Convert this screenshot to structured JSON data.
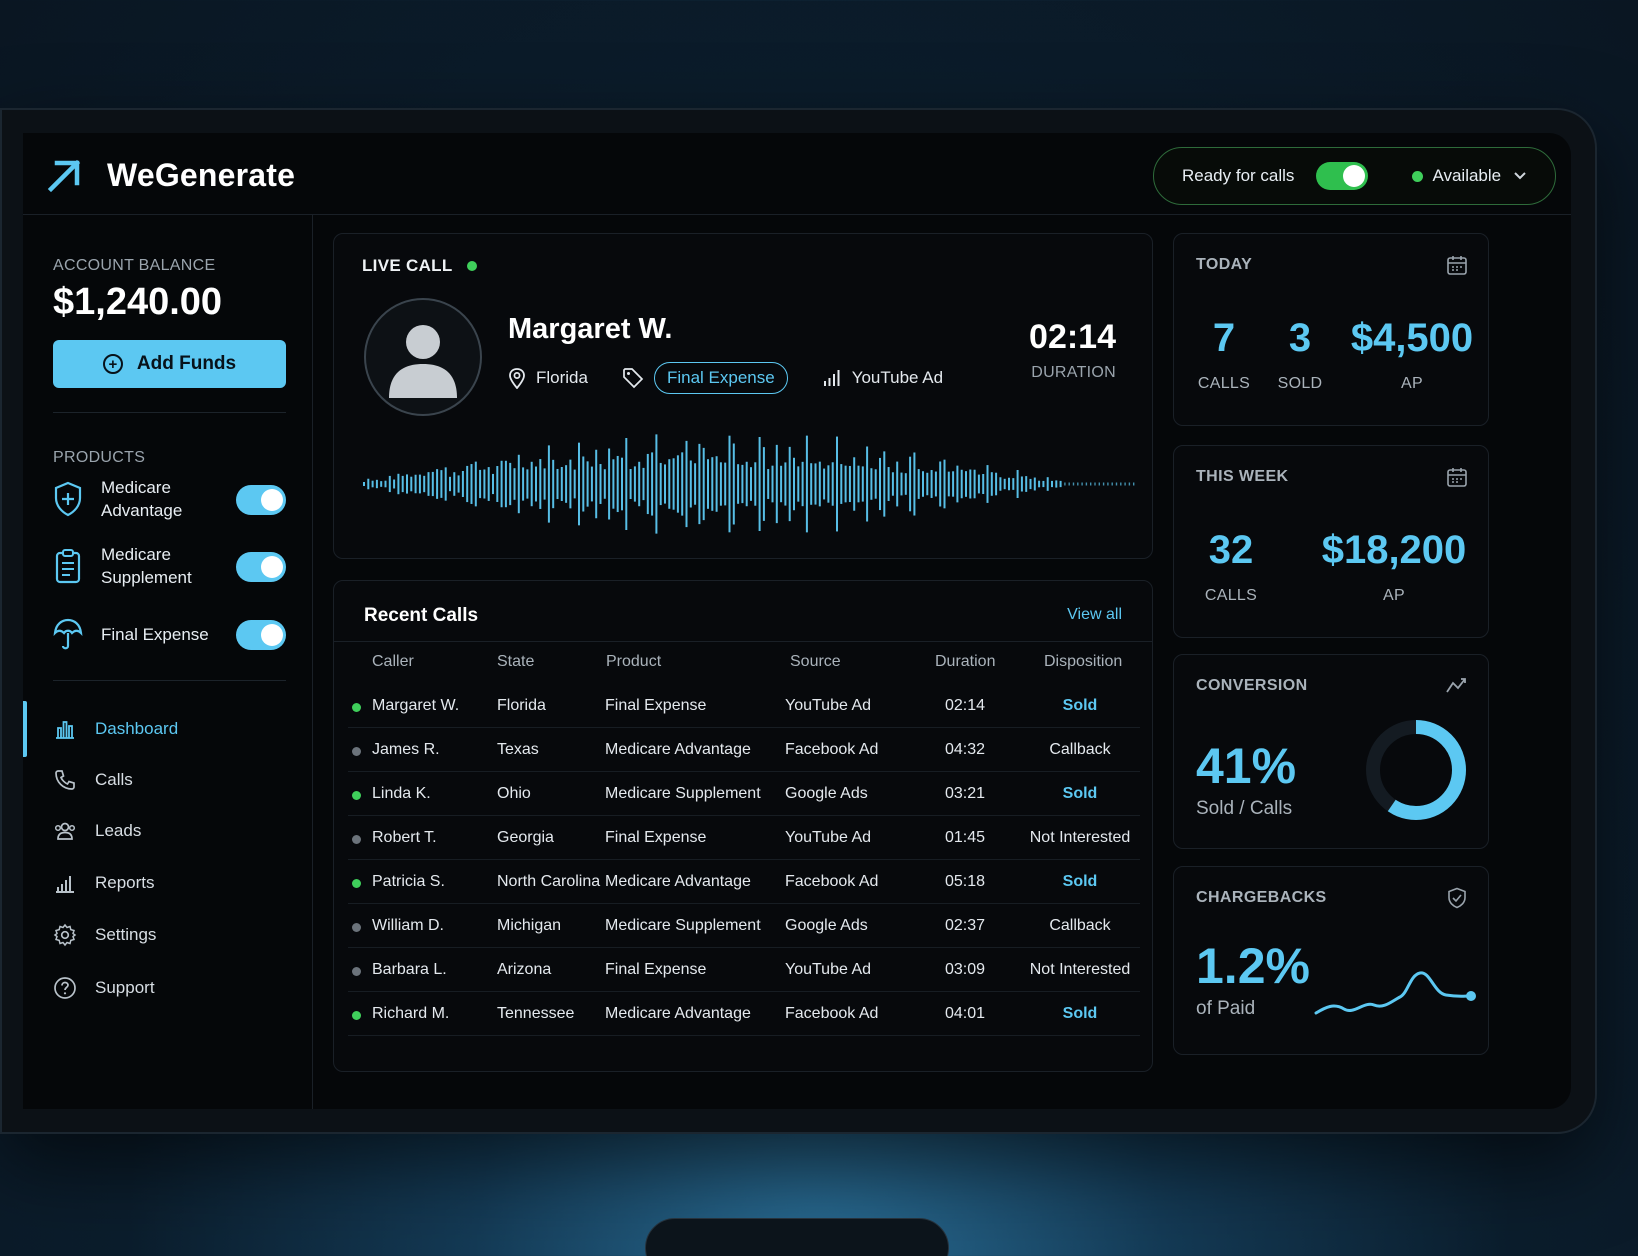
{
  "app": {
    "name": "WeGenerate"
  },
  "status": {
    "ready_label": "Ready for calls",
    "availability": "Available"
  },
  "sidebar": {
    "balance_label": "ACCOUNT BALANCE",
    "balance_value": "$1,240.00",
    "add_funds_label": "Add Funds",
    "products_label": "PRODUCTS",
    "products": [
      {
        "name": "Medicare Advantage",
        "icon": "shield-plus-icon",
        "enabled": true
      },
      {
        "name": "Medicare Supplement",
        "icon": "clipboard-icon",
        "enabled": true
      },
      {
        "name": "Final Expense",
        "icon": "umbrella-icon",
        "enabled": true
      }
    ],
    "nav": [
      {
        "label": "Dashboard",
        "icon": "dashboard-icon",
        "active": true
      },
      {
        "label": "Calls",
        "icon": "phone-icon"
      },
      {
        "label": "Leads",
        "icon": "users-icon"
      },
      {
        "label": "Reports",
        "icon": "bar-chart-icon"
      },
      {
        "label": "Settings",
        "icon": "gear-icon"
      },
      {
        "label": "Support",
        "icon": "help-icon"
      }
    ]
  },
  "live_call": {
    "title": "LIVE CALL",
    "caller": "Margaret W.",
    "state": "Florida",
    "product": "Final Expense",
    "source": "YouTube Ad",
    "duration": "02:14",
    "duration_label": "DURATION"
  },
  "recent_calls": {
    "title": "Recent Calls",
    "view_all": "View all",
    "columns": [
      "Caller",
      "State",
      "Product",
      "Source",
      "Duration",
      "Disposition"
    ],
    "rows": [
      {
        "caller": "Margaret W.",
        "state": "Florida",
        "product": "Final Expense",
        "source": "YouTube Ad",
        "duration": "02:14",
        "disposition": "Sold"
      },
      {
        "caller": "James R.",
        "state": "Texas",
        "product": "Medicare Advantage",
        "source": "Facebook Ad",
        "duration": "04:32",
        "disposition": "Callback"
      },
      {
        "caller": "Linda K.",
        "state": "Ohio",
        "product": "Medicare Supplement",
        "source": "Google Ads",
        "duration": "03:21",
        "disposition": "Sold"
      },
      {
        "caller": "Robert T.",
        "state": "Georgia",
        "product": "Final Expense",
        "source": "YouTube Ad",
        "duration": "01:45",
        "disposition": "Not Interested"
      },
      {
        "caller": "Patricia S.",
        "state": "North Carolina",
        "product": "Medicare Advantage",
        "source": "Facebook Ad",
        "duration": "05:18",
        "disposition": "Sold"
      },
      {
        "caller": "William D.",
        "state": "Michigan",
        "product": "Medicare Supplement",
        "source": "Google Ads",
        "duration": "02:37",
        "disposition": "Callback"
      },
      {
        "caller": "Barbara L.",
        "state": "Arizona",
        "product": "Final Expense",
        "source": "YouTube Ad",
        "duration": "03:09",
        "disposition": "Not Interested"
      },
      {
        "caller": "Richard M.",
        "state": "Tennessee",
        "product": "Medicare Advantage",
        "source": "Facebook Ad",
        "duration": "04:01",
        "disposition": "Sold"
      }
    ]
  },
  "today": {
    "title": "TODAY",
    "calls": "7",
    "calls_label": "CALLS",
    "sold": "3",
    "sold_label": "SOLD",
    "ap": "$4,500",
    "ap_label": "AP"
  },
  "week": {
    "title": "THIS WEEK",
    "calls": "32",
    "calls_label": "CALLS",
    "ap": "$18,200",
    "ap_label": "AP"
  },
  "conversion": {
    "title": "CONVERSION",
    "value": "41%",
    "label": "Sold / Calls",
    "fraction": 0.41
  },
  "chargebacks": {
    "title": "CHARGEBACKS",
    "value": "1.2%",
    "label": "of Paid"
  },
  "colors": {
    "accent": "#5cc8f2",
    "green": "#3fcf5b",
    "background": "#050709"
  }
}
